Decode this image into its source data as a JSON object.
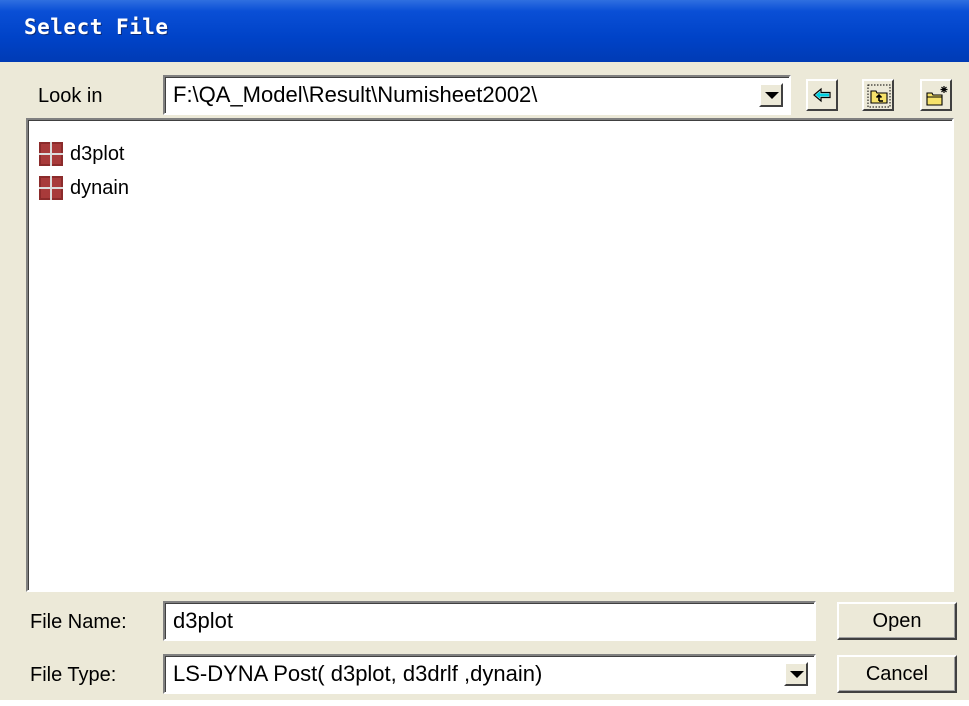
{
  "window": {
    "title": "Select File"
  },
  "look_in": {
    "label": "Look in",
    "path": "F:\\QA_Model\\Result\\Numisheet2002\\",
    "dropdown_icon": "chevron-down-icon"
  },
  "toolbar": {
    "back_icon": "back-arrow-icon",
    "up_folder_icon": "up-folder-icon",
    "new_folder_icon": "new-folder-icon"
  },
  "files": [
    {
      "name": "d3plot",
      "icon": "grid-file-icon"
    },
    {
      "name": "dynain",
      "icon": "grid-file-icon"
    }
  ],
  "file_name": {
    "label": "File Name:",
    "value": "d3plot"
  },
  "file_type": {
    "label": "File Type:",
    "value": "LS-DYNA Post( d3plot, d3drlf ,dynain)"
  },
  "buttons": {
    "open": "Open",
    "cancel": "Cancel"
  },
  "colors": {
    "title_bar": "#0043c8",
    "dialog_bg": "#ece9d8",
    "file_icon": "#8b2b2b"
  }
}
